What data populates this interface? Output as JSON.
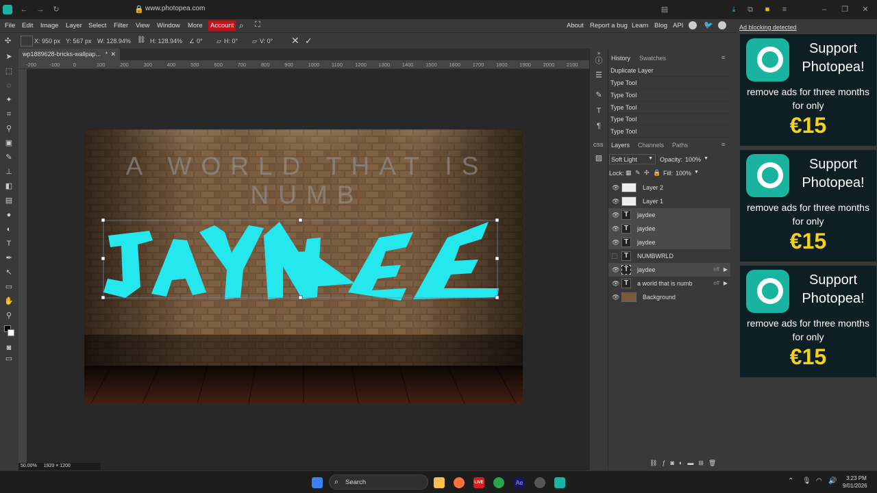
{
  "browser": {
    "url": "www.photopea.com"
  },
  "menu": {
    "items": [
      "File",
      "Edit",
      "Image",
      "Layer",
      "Select",
      "Filter",
      "View",
      "Window",
      "More"
    ],
    "account": "Account",
    "right_links": [
      "About",
      "Report a bug",
      "Learn",
      "Blog",
      "API"
    ]
  },
  "options": {
    "x": "X: 950 px",
    "y": "Y: 567 px",
    "w": "W: 128.94%",
    "h": "H: 128.94%",
    "angle": "0°",
    "hskew": "H: 0°",
    "vskew": "V: 0°"
  },
  "document": {
    "tab": "wp1889628-bricks-wallpap...",
    "modified": "*",
    "zoom": "50.00%",
    "size": "1920 × 1200"
  },
  "ruler": {
    "labels": [
      "-200",
      "-100",
      "0",
      "100",
      "200",
      "300",
      "400",
      "500",
      "600",
      "700",
      "800",
      "900",
      "1000",
      "1100",
      "1200",
      "1300",
      "1400",
      "1500",
      "1600",
      "1700",
      "1800",
      "1900",
      "2000",
      "2100"
    ]
  },
  "artwork": {
    "top_text": "A WORLD THAT IS NUMB",
    "graffiti_text": "JAYDEE"
  },
  "history": {
    "tabs": [
      "History",
      "Swatches"
    ],
    "items": [
      "Duplicate Layer",
      "Type Tool",
      "Type Tool",
      "Type Tool",
      "Type Tool",
      "Type Tool"
    ]
  },
  "layers": {
    "tabs": [
      "Layers",
      "Channels",
      "Paths"
    ],
    "blend_mode": "Soft Light",
    "opacity_label": "Opacity:",
    "opacity": "100%",
    "lock_label": "Lock:",
    "fill_label": "Fill:",
    "fill": "100%",
    "items": [
      {
        "name": "Layer 2",
        "kind": "raster",
        "visible": true,
        "selected": false
      },
      {
        "name": "Layer 1",
        "kind": "raster",
        "visible": true,
        "selected": false
      },
      {
        "name": "jaydee",
        "kind": "text",
        "visible": true,
        "selected": true
      },
      {
        "name": "jaydee",
        "kind": "text",
        "visible": true,
        "selected": true
      },
      {
        "name": "jaydee",
        "kind": "text",
        "visible": true,
        "selected": true
      },
      {
        "name": "NUMBWRLD",
        "kind": "text",
        "visible": false,
        "selected": false
      },
      {
        "name": "jaydee",
        "kind": "text",
        "visible": true,
        "selected": false,
        "fx": "eff"
      },
      {
        "name": "a world that is numb",
        "kind": "text",
        "visible": true,
        "selected": false,
        "fx": "eff"
      },
      {
        "name": "Background",
        "kind": "image",
        "visible": true,
        "selected": false
      }
    ]
  },
  "ad": {
    "notice": "Ad blocking detected",
    "title": "Support Photopea!",
    "subtitle": "remove ads for three months for only",
    "price": "€15"
  },
  "taskbar": {
    "search": "Search",
    "time": "3:23 PM",
    "date": "9/01/2026"
  },
  "colors": {
    "accent_account": "#c0121b",
    "graffiti": "#25e8ee",
    "ad_price": "#f3d21c",
    "ad_logo": "#19b49f"
  }
}
